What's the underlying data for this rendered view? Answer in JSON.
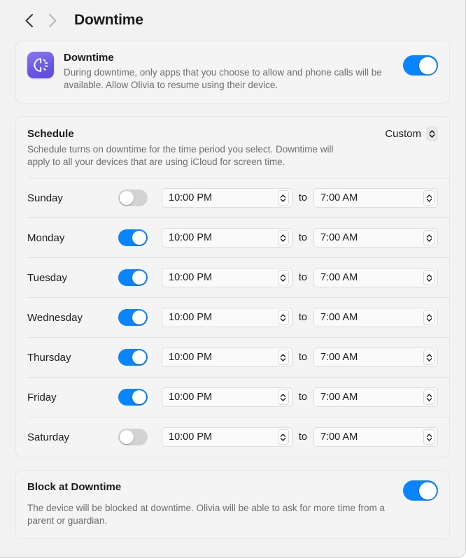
{
  "window": {
    "background": "#f2f2f2",
    "accent": "#0a84ff"
  },
  "nav": {
    "back_icon": "chevron-left-icon",
    "forward_icon": "chevron-right-icon",
    "title": "Downtime"
  },
  "downtime": {
    "icon": "downtime-app-icon",
    "title": "Downtime",
    "description": "During downtime, only apps that you choose to allow and phone calls will be available. Allow Olivia to resume using their device.",
    "enabled": true
  },
  "schedule": {
    "title": "Schedule",
    "description": "Schedule turns on downtime for the time period you select. Downtime will apply to all your devices that are using iCloud for screen time.",
    "mode_value": "Custom",
    "mode_icon": "up-down-chevron-icon",
    "to_label": "to",
    "days": [
      {
        "name": "Sunday",
        "enabled": false,
        "start": "10:00 PM",
        "end": "7:00 AM"
      },
      {
        "name": "Monday",
        "enabled": true,
        "start": "10:00 PM",
        "end": "7:00 AM"
      },
      {
        "name": "Tuesday",
        "enabled": true,
        "start": "10:00 PM",
        "end": "7:00 AM"
      },
      {
        "name": "Wednesday",
        "enabled": true,
        "start": "10:00 PM",
        "end": "7:00 AM"
      },
      {
        "name": "Thursday",
        "enabled": true,
        "start": "10:00 PM",
        "end": "7:00 AM"
      },
      {
        "name": "Friday",
        "enabled": true,
        "start": "10:00 PM",
        "end": "7:00 AM"
      },
      {
        "name": "Saturday",
        "enabled": false,
        "start": "10:00 PM",
        "end": "7:00 AM"
      }
    ]
  },
  "block_at_downtime": {
    "title": "Block at Downtime",
    "description": "The device will be blocked at downtime. Olivia will be able to ask for more time from a parent or guardian.",
    "enabled": true
  }
}
